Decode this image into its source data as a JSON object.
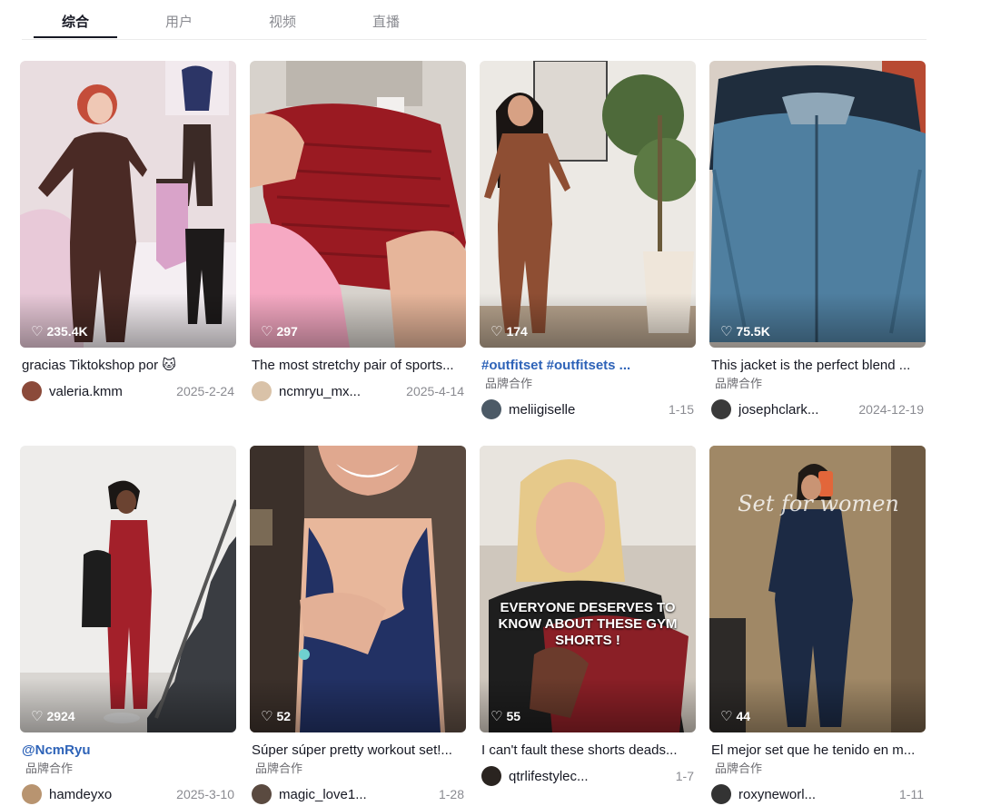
{
  "tabs": [
    "综合",
    "用户",
    "视频",
    "直播"
  ],
  "brand_label": "品牌合作",
  "heart_glyph": "♡",
  "cards": [
    {
      "likes": "235.4K",
      "desc": "gracias Tiktokshop por 🐱",
      "author": "valeria.kmm",
      "date": "2025-2-24",
      "avatar_color": "#8b4a3a",
      "brand": false
    },
    {
      "likes": "297",
      "desc": "The most stretchy pair of sports...",
      "author": "ncmryu_mx...",
      "date": "2025-4-14",
      "avatar_color": "#d9c2a8",
      "brand": false
    },
    {
      "likes": "174",
      "desc": "#outfitset #outfitsets ...",
      "author": "meliigiselle",
      "date": "1-15",
      "avatar_color": "#4c5a66",
      "brand": true
    },
    {
      "likes": "75.5K",
      "desc": "This jacket is the perfect blend ...",
      "author": "josephclark...",
      "date": "2024-12-19",
      "avatar_color": "#3a3a3a",
      "brand": true
    },
    {
      "likes": "2924",
      "desc": "@NcmRyu",
      "author": "hamdeyxo",
      "date": "2025-3-10",
      "avatar_color": "#b89470",
      "brand": true
    },
    {
      "likes": "52",
      "desc": "Súper súper pretty workout set!...",
      "author": "magic_love1...",
      "date": "1-28",
      "avatar_color": "#5a4a40",
      "brand": true
    },
    {
      "likes": "55",
      "desc": "I can't fault these shorts deads...",
      "author": "qtrlifestylec...",
      "date": "1-7",
      "avatar_color": "#2a2420",
      "brand": false,
      "overlay": "EVERYONE DESERVES TO KNOW ABOUT THESE GYM SHORTS !"
    },
    {
      "likes": "44",
      "desc": "El mejor set que he tenido en m...",
      "author": "roxyneworl...",
      "date": "1-11",
      "avatar_color": "#333333",
      "brand": true,
      "overlay": "Set for women"
    }
  ]
}
